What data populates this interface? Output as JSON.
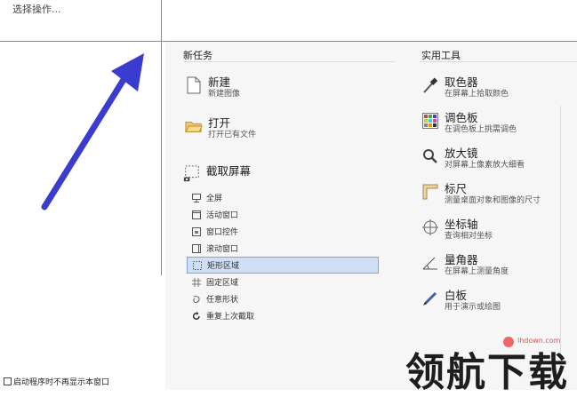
{
  "top": {
    "hint": "选择操作..."
  },
  "footer": {
    "startup_label": "启动程序时不再显示本窗口"
  },
  "tasks": {
    "heading": "新任务",
    "new": {
      "title": "新建",
      "sub": "新建图像"
    },
    "open": {
      "title": "打开",
      "sub": "打开已有文件"
    },
    "capture": {
      "title": "截取屏幕"
    },
    "capture_items": [
      {
        "label": "全屏",
        "icon": "monitor-icon"
      },
      {
        "label": "活动窗口",
        "icon": "window-icon"
      },
      {
        "label": "窗口控件",
        "icon": "window-control-icon"
      },
      {
        "label": "滚动窗口",
        "icon": "scroll-window-icon"
      },
      {
        "label": "矩形区域",
        "icon": "rectangle-region-icon"
      },
      {
        "label": "固定区域",
        "icon": "fixed-region-icon"
      },
      {
        "label": "任意形状",
        "icon": "freeform-icon"
      },
      {
        "label": "重复上次截取",
        "icon": "repeat-icon"
      }
    ]
  },
  "tools": {
    "heading": "实用工具",
    "items": [
      {
        "title": "取色器",
        "sub": "在屏幕上拾取颜色",
        "icon": "eyedropper-icon"
      },
      {
        "title": "调色板",
        "sub": "在调色板上挑需调色",
        "icon": "palette-icon"
      },
      {
        "title": "放大镜",
        "sub": "对屏幕上像素放大细看",
        "icon": "magnifier-icon"
      },
      {
        "title": "标尺",
        "sub": "测量桌面对象和图像的尺寸",
        "icon": "ruler-icon"
      },
      {
        "title": "坐标轴",
        "sub": "查询相对坐标",
        "icon": "crosshair-icon"
      },
      {
        "title": "量角器",
        "sub": "在屏幕上测量角度",
        "icon": "protractor-icon"
      },
      {
        "title": "白板",
        "sub": "用于演示或绘图",
        "icon": "pen-icon"
      }
    ]
  },
  "watermark": {
    "text": "领航下载",
    "url": "lhdown.com"
  },
  "colors": {
    "arrow": "#3a3ccf",
    "selection": "#cfe0f6"
  }
}
